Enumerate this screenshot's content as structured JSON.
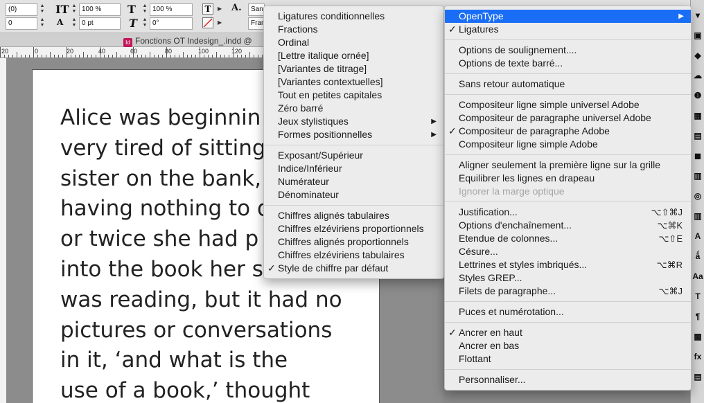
{
  "control_panel": {
    "field_a": "(0)",
    "field_b": "0",
    "vertical_scale": "100 %",
    "baseline_shift": "0 pt",
    "horizontal_scale": "100 %",
    "skew": "0°",
    "font_name": "San",
    "font_style": "Fran"
  },
  "document_tab": {
    "title": "Fonctions OT Indesign_.indd @"
  },
  "ruler": {
    "labels": [
      "20",
      "0",
      "20",
      "40",
      "60",
      "80",
      "100",
      "120"
    ]
  },
  "page_text": {
    "lines": [
      "Alice was beginnin",
      "very tired of sitting",
      "sister on the bank,",
      "having nothing to d",
      "or twice she had p",
      "into the book her s",
      "was reading, but it had no",
      "pictures or conversations",
      "in it, ‘and what is the",
      "use of a book,’ thought"
    ]
  },
  "submenu": {
    "groups": [
      [
        {
          "label": "Ligatures conditionnelles"
        },
        {
          "label": "Fractions"
        },
        {
          "label": "Ordinal"
        },
        {
          "label": "[Lettre italique ornée]"
        },
        {
          "label": "[Variantes de titrage]"
        },
        {
          "label": "[Variantes contextuelles]"
        },
        {
          "label": "Tout en petites capitales"
        },
        {
          "label": "Zéro barré"
        },
        {
          "label": "Jeux stylistiques",
          "arrow": "▶"
        },
        {
          "label": "Formes positionnelles",
          "arrow": "▶"
        }
      ],
      [
        {
          "label": "Exposant/Supérieur"
        },
        {
          "label": "Indice/Inférieur"
        },
        {
          "label": "Numérateur"
        },
        {
          "label": "Dénominateur"
        }
      ],
      [
        {
          "label": "Chiffres alignés tabulaires"
        },
        {
          "label": "Chiffres elzéviriens proportionnels"
        },
        {
          "label": "Chiffres alignés proportionnels"
        },
        {
          "label": "Chiffres elzéviriens tabulaires"
        },
        {
          "label": "Style de chiffre par défaut",
          "checked": "✓"
        }
      ]
    ]
  },
  "main_menu": {
    "groups": [
      [
        {
          "label": "OpenType",
          "arrow": "▶",
          "highlight": true
        },
        {
          "label": "Ligatures",
          "checked": "✓"
        }
      ],
      [
        {
          "label": "Options de soulignement...."
        },
        {
          "label": "Options de texte barré..."
        }
      ],
      [
        {
          "label": "Sans retour automatique"
        }
      ],
      [
        {
          "label": "Compositeur ligne simple universel Adobe"
        },
        {
          "label": "Compositeur de paragraphe universel Adobe"
        },
        {
          "label": "Compositeur de paragraphe Adobe",
          "checked": "✓"
        },
        {
          "label": "Compositeur ligne simple Adobe"
        }
      ],
      [
        {
          "label": "Aligner seulement la première ligne sur la grille"
        },
        {
          "label": "Equilibrer les lignes en drapeau"
        },
        {
          "label": "Ignorer la marge optique",
          "disabled": true
        }
      ],
      [
        {
          "label": "Justification...",
          "shortcut": "⌥⇧⌘J"
        },
        {
          "label": "Options d'enchaînement...",
          "shortcut": "⌥⌘K"
        },
        {
          "label": "Etendue de colonnes...",
          "shortcut": "⌥⇧E"
        },
        {
          "label": "Césure..."
        },
        {
          "label": "Lettrines et styles imbriqués...",
          "shortcut": "⌥⌘R"
        },
        {
          "label": "Styles GREP..."
        },
        {
          "label": "Filets de paragraphe...",
          "shortcut": "⌥⌘J"
        }
      ],
      [
        {
          "label": "Puces et numérotation..."
        }
      ],
      [
        {
          "label": "Ancrer en haut",
          "checked": "✓"
        },
        {
          "label": "Ancrer en bas"
        },
        {
          "label": "Flottant"
        }
      ],
      [
        {
          "label": "Personnaliser..."
        }
      ]
    ]
  },
  "side_panel": {
    "glyphs": [
      "▾",
      "▣",
      "◆",
      "☁",
      "❶",
      "▦",
      "▤",
      "◼",
      "▥",
      "◎",
      "▥",
      "A",
      "ǻ",
      "Aa",
      "T",
      "¶",
      "▩",
      "fx",
      "▤"
    ]
  }
}
